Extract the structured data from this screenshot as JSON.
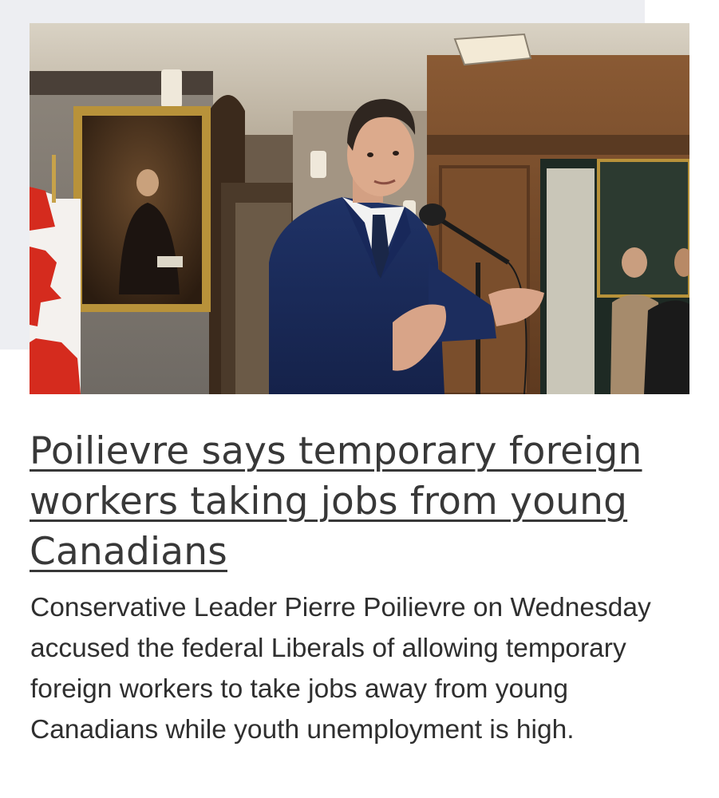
{
  "article": {
    "image_alt": "Pierre Poilievre speaking at a microphone",
    "headline": "Poilievre says temporary foreign workers taking jobs from young Canadians",
    "summary": "Conservative Leader Pierre Poilievre on Wednesday accused the federal Liberals of allowing temporary foreign workers to take jobs away from young Canadians while youth unemployment is high."
  },
  "colors": {
    "page_background": "#ffffff",
    "panel_background": "#edeef2",
    "headline_text": "#383838",
    "body_text": "#2f2f2f",
    "flag_red": "#d52b1e"
  }
}
